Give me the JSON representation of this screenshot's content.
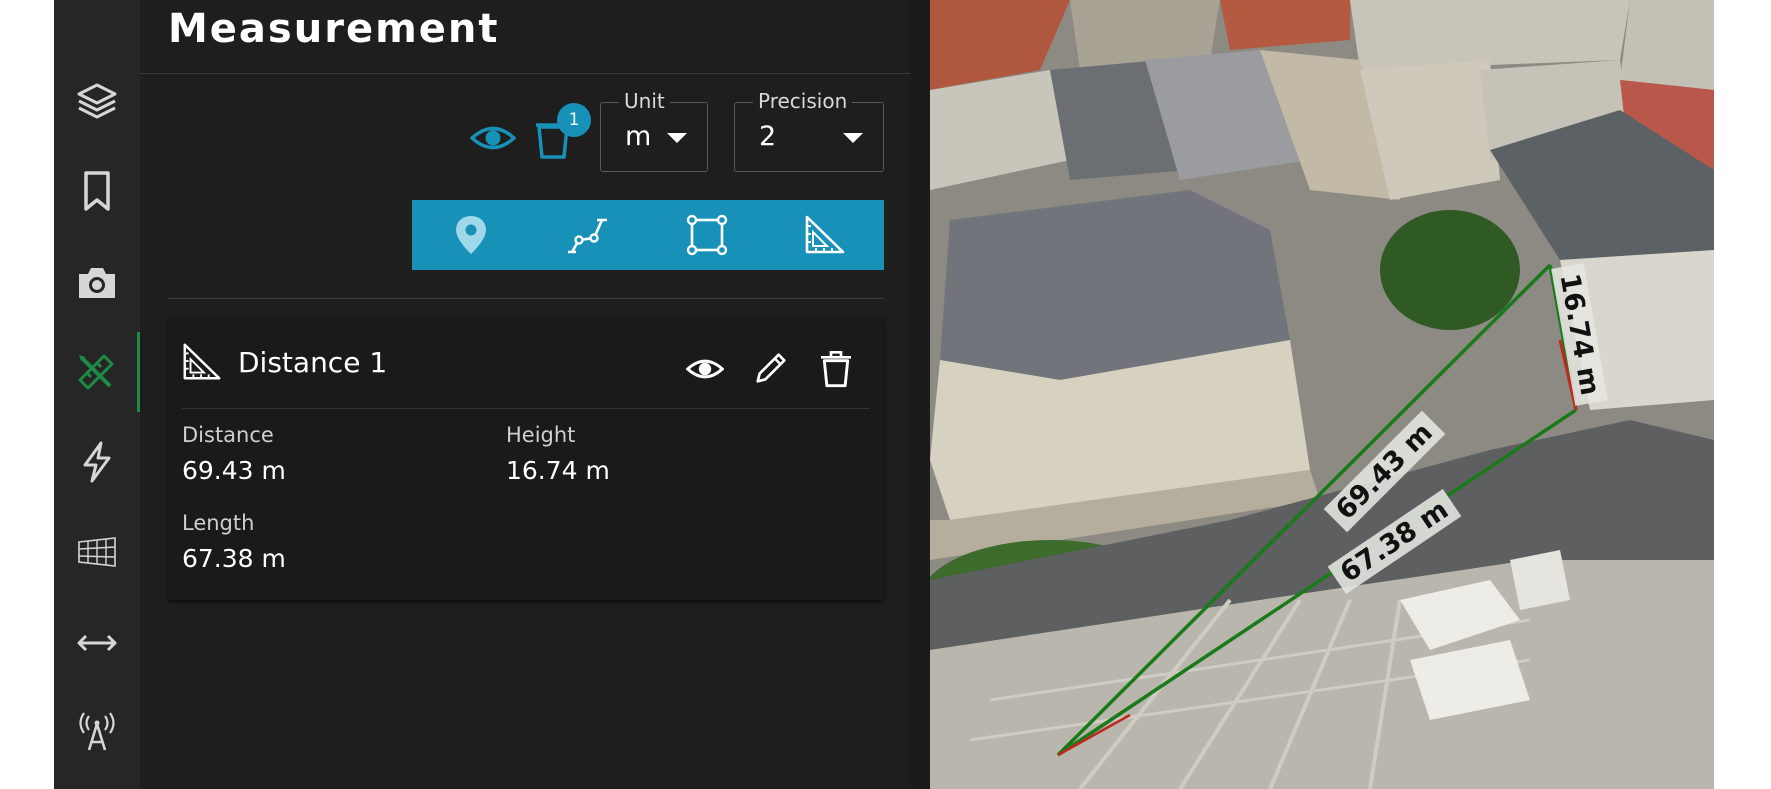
{
  "rail": {
    "items": [
      {
        "icon": "layers-icon"
      },
      {
        "icon": "bookmark-icon"
      },
      {
        "icon": "camera-icon"
      },
      {
        "icon": "measure-tools-icon",
        "active": true
      },
      {
        "icon": "lightning-icon"
      },
      {
        "icon": "grid-icon"
      },
      {
        "icon": "arrows-horizontal-icon"
      },
      {
        "icon": "antenna-icon"
      }
    ],
    "active_color": "#1e8c45"
  },
  "panel": {
    "title": "Measurement",
    "badge_count": "1",
    "unit": {
      "legend": "Unit",
      "value": "m"
    },
    "precision": {
      "legend": "Precision",
      "value": "2"
    },
    "tools": [
      "point-tool-icon",
      "polyline-tool-icon",
      "area-tool-icon",
      "distance-tool-icon"
    ],
    "accent_color": "#1791b8"
  },
  "measurement": {
    "name": "Distance 1",
    "fields": {
      "distance_label": "Distance",
      "distance_value": "69.43 m",
      "height_label": "Height",
      "height_value": "16.74 m",
      "length_label": "Length",
      "length_value": "67.38 m"
    }
  },
  "map": {
    "labels": {
      "distance": "69.43 m",
      "length": "67.38 m",
      "height": "16.74 m"
    },
    "line_color": "#1a7a1a",
    "segment_color": "#c0281e"
  }
}
